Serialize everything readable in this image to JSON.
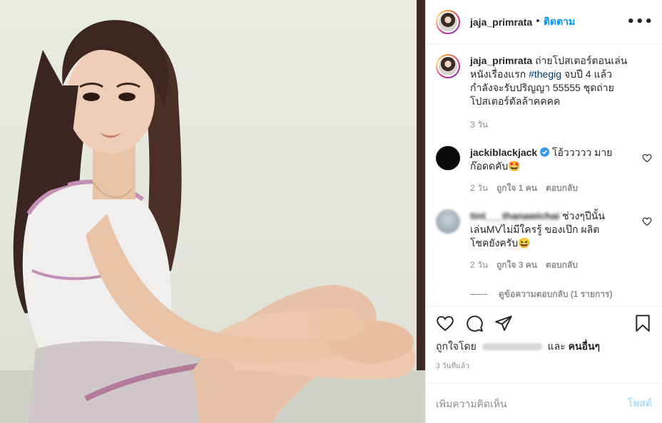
{
  "header": {
    "username": "jaja_primrata",
    "separator": "•",
    "follow_label": "ติดตาม",
    "more_icon": "•••"
  },
  "caption": {
    "username": "jaja_primrata",
    "text_before": "ถ่ายโปสเตอร์ตอนเล่นหนังเรื่องแรก",
    "hashtag": "#thegig",
    "text_after": "จบปี 4 แล้วกำลังจะรับปริญญา 55555 ชุดถ่ายโปสเตอร์ตัลล้าคคคค",
    "time": "3 วัน"
  },
  "comments": [
    {
      "username": "jackiblackjack",
      "verified": true,
      "text": "โอ้ววววว มาย ก๊อดดคับ🤩",
      "time": "2 วัน",
      "likes": "ถูกใจ 1 คน",
      "reply_label": "ตอบกลับ"
    },
    {
      "username": "tint___thanawichai",
      "text": "ช่วงๆปีนั้นเล่นMVไม่มีใครรู้ ของเป๊ก ผลิตโชคยังครับ😆",
      "time": "2 วัน",
      "likes": "ถูกใจ 3 คน",
      "reply_label": "ตอบกลับ",
      "view_replies": "ดูข้อความตอบกลับ (1 รายการ)"
    }
  ],
  "actions": {
    "icons": [
      "heart-icon",
      "comment-icon",
      "share-icon",
      "bookmark-icon"
    ],
    "liked_prefix": "ถูกใจโดย",
    "liked_and": "และ",
    "liked_others": "คนอื่นๆ",
    "posted_ago": "3 วันที่แล้ว"
  },
  "add_comment": {
    "placeholder": "เพิ่มความคิดเห็น",
    "post_label": "โพสต์"
  },
  "colors": {
    "link": "#0095f6",
    "hashtag": "#00376b",
    "muted": "#8e8e8e",
    "verified": "#3897f0"
  }
}
